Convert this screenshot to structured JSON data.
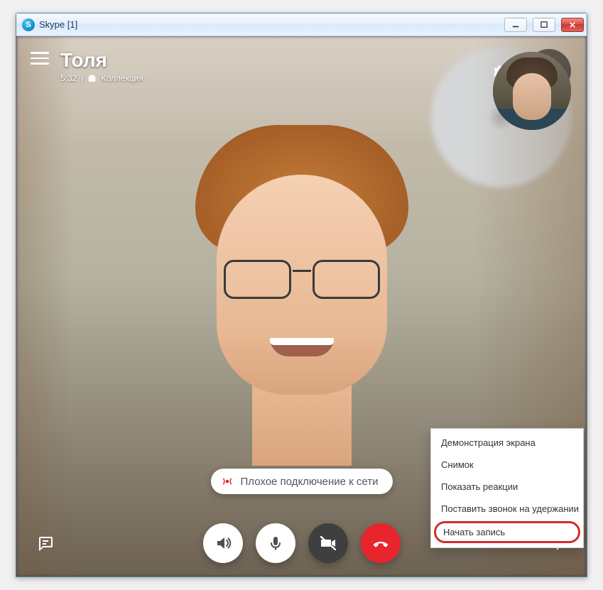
{
  "window": {
    "title": "Skype [1]",
    "app_icon_letter": "S"
  },
  "call": {
    "contact_name": "Толя",
    "duration": "5:32",
    "separator": "|",
    "collection_label": "Коллекция"
  },
  "connection": {
    "message": "Плохое подключение к сети"
  },
  "context_menu": {
    "items": [
      {
        "label": "Демонстрация экрана"
      },
      {
        "label": "Снимок"
      },
      {
        "label": "Показать реакции"
      },
      {
        "label": "Поставить звонок на удержании"
      },
      {
        "label": "Начать запись"
      }
    ],
    "highlight_index": 4
  },
  "colors": {
    "end_call": "#e8252c",
    "highlight_border": "#d82b2b",
    "signal_icon": "#e8252c"
  }
}
